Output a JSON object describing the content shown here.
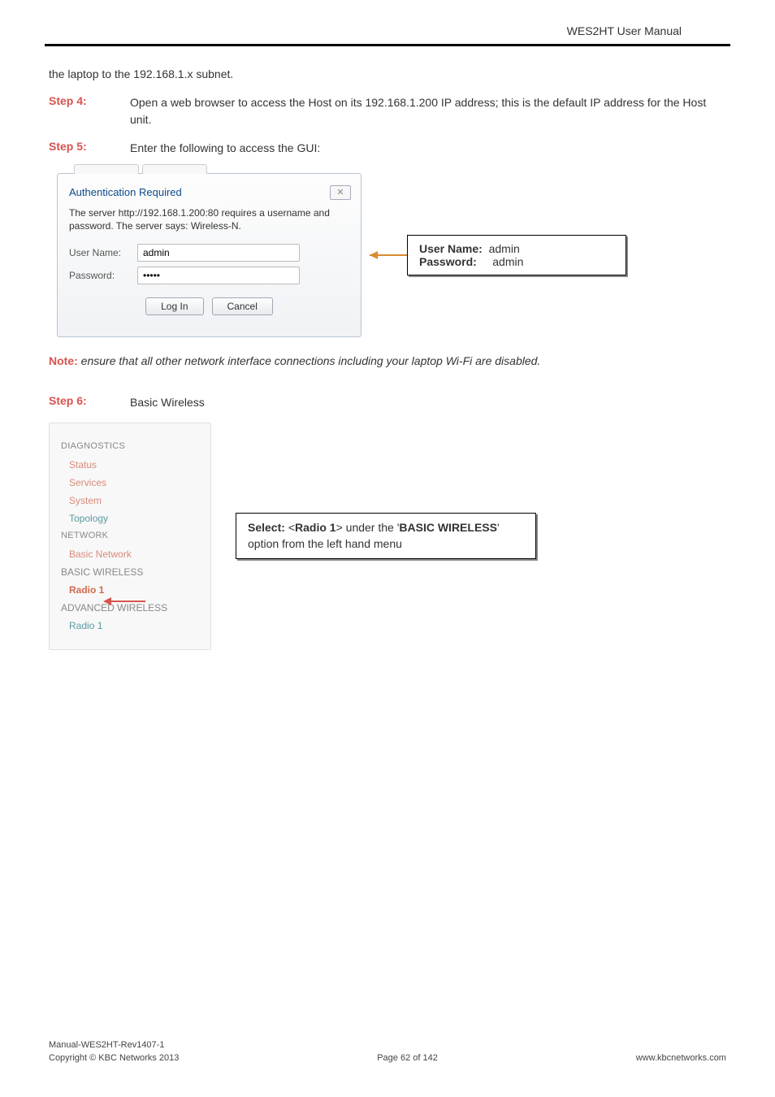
{
  "header": {
    "title": "WES2HT User Manual"
  },
  "intro": "the laptop to the 192.168.1.x subnet.",
  "step4": {
    "label": "Step 4:",
    "text": "Open a web browser to access the Host on its 192.168.1.200 IP address; this is the default IP address for the Host unit."
  },
  "step5": {
    "label": "Step 5:",
    "text": "Enter the following to access the GUI:"
  },
  "dialog": {
    "title": "Authentication Required",
    "close_glyph": "✕",
    "message": "The server http://192.168.1.200:80 requires a username and password. The server says: Wireless-N.",
    "username_label": "User Name:",
    "username_value": "admin",
    "password_label": "Password:",
    "password_value": "•••••",
    "login_btn": "Log In",
    "cancel_btn": "Cancel"
  },
  "creds_callout": {
    "line1a": "User Name:",
    "line1b": "admin",
    "line2a": "Password:",
    "line2b": "admin"
  },
  "note": {
    "label": "Note:",
    "text": " ensure that all other network interface connections including your laptop Wi-Fi are disabled."
  },
  "step6": {
    "label": "Step 6:",
    "text": "Basic Wireless"
  },
  "sidebar": {
    "diag": "DIAGNOSTICS",
    "status": "Status",
    "services": "Services",
    "system": "System",
    "topology": "Topology",
    "network": "NETWORK",
    "basic_net": "Basic Network",
    "basic_wireless": "BASIC WIRELESS",
    "radio1": "Radio 1",
    "adv_wireless": "ADVANCED WIRELESS",
    "radio1b": "Radio 1"
  },
  "select_callout": {
    "prefix": "Select:  ",
    "radio": "Radio 1",
    "mid": " under the '",
    "bw": "BASIC WIRELESS",
    "suffix": "' option from the left hand menu"
  },
  "footer": {
    "left1": "Manual-WES2HT-Rev1407-1",
    "left2": "Copyright © KBC Networks 2013",
    "center": "Page 62 of 142",
    "right": "www.kbcnetworks.com"
  }
}
